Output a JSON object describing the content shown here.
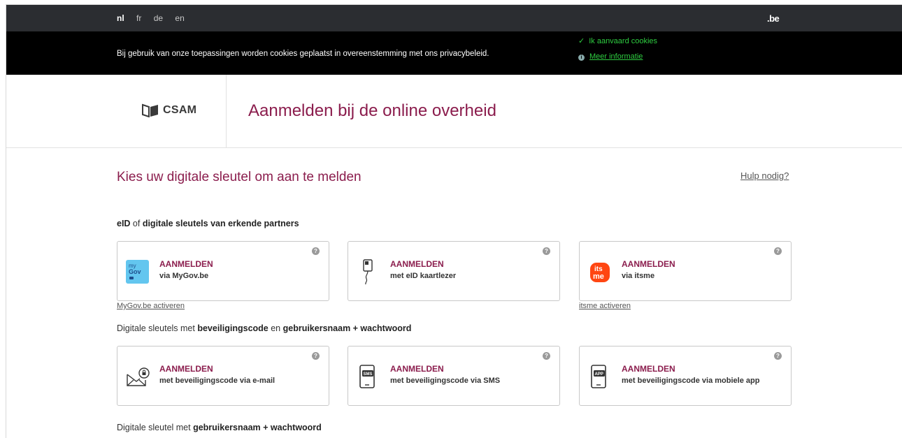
{
  "languages": [
    {
      "code": "nl",
      "active": true
    },
    {
      "code": "fr",
      "active": false
    },
    {
      "code": "de",
      "active": false
    },
    {
      "code": "en",
      "active": false
    }
  ],
  "be_logo": ".be",
  "cookie": {
    "text": "Bij gebruik van onze toepassingen worden cookies geplaatst in overeenstemming met ons privacybeleid.",
    "accept": "Ik aanvaard cookies",
    "more": "Meer informatie"
  },
  "header": {
    "brand": "CSAM",
    "title": "Aanmelden bij de online overheid"
  },
  "main": {
    "title": "Kies uw digitale sleutel om aan te melden",
    "help": "Hulp nodig?",
    "section1": {
      "a": "eID",
      "b": " of ",
      "c": "digitale sleutels van erkende partners"
    },
    "section2": {
      "a": "Digitale sleutels met ",
      "b": "beveiligingscode",
      "c": " en ",
      "d": "gebruikersnaam + wachtwoord"
    },
    "section3": {
      "a": "Digitale sleutel met ",
      "b": "gebruikersnaam + wachtwoord"
    }
  },
  "cards": [
    {
      "title": "AANMELDEN",
      "sub": "via MyGov.be",
      "icon": "mygov-icon"
    },
    {
      "title": "AANMELDEN",
      "sub": "met eID kaartlezer",
      "icon": "card-reader-icon"
    },
    {
      "title": "AANMELDEN",
      "sub": "via itsme",
      "icon": "itsme-icon"
    },
    {
      "title": "AANMELDEN",
      "sub": "met beveiligingscode via e-mail",
      "icon": "email-lock-icon"
    },
    {
      "title": "AANMELDEN",
      "sub": "met beveiligingscode via SMS",
      "icon": "sms-phone-icon"
    },
    {
      "title": "AANMELDEN",
      "sub": "met beveiligingscode via mobiele app",
      "icon": "app-phone-icon"
    }
  ],
  "links": {
    "mygov_activate": "MyGov.be activeren",
    "itsme_activate": "itsme activeren"
  },
  "icon_text": {
    "mygov_my": "my",
    "mygov_gov": "Gov",
    "itsme_its": "its",
    "itsme_me": "me",
    "sms": "SMS",
    "app": "APP"
  },
  "colors": {
    "accent": "#8b1d4d",
    "cookie_green": "#2ecc40",
    "topbar": "#2b2d31",
    "itsme": "#ff4612",
    "mygov": "#63c6ef"
  }
}
